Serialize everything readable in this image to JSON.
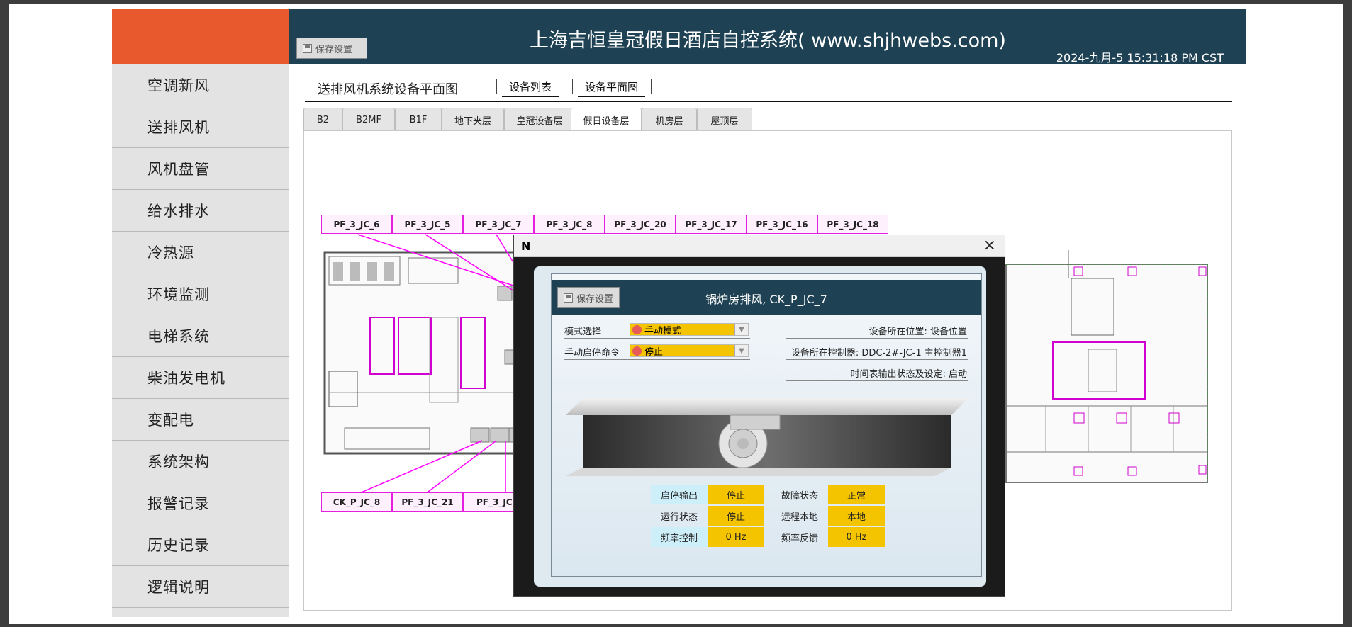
{
  "header": {
    "title": "上海吉恒皇冠假日酒店自控系统( www.shjhwebs.com)",
    "save_label": "保存设置",
    "datetime": "2024-九月-5 15:31:18 PM CST"
  },
  "sidebar": {
    "items": [
      {
        "label": "空调新风"
      },
      {
        "label": "送排风机"
      },
      {
        "label": "风机盘管"
      },
      {
        "label": "给水排水"
      },
      {
        "label": "冷热源"
      },
      {
        "label": "环境监测"
      },
      {
        "label": "电梯系统"
      },
      {
        "label": "柴油发电机"
      },
      {
        "label": "变配电"
      },
      {
        "label": "系统架构"
      },
      {
        "label": "报警记录"
      },
      {
        "label": "历史记录"
      },
      {
        "label": "逻辑说明"
      }
    ]
  },
  "subnav": {
    "title": "送排风机系统设备平面图",
    "links": [
      "设备列表",
      "设备平面图"
    ]
  },
  "tabs": {
    "items": [
      "B2",
      "B2MF",
      "B1F",
      "地下夹层",
      "皇冠设备层",
      "假日设备层",
      "机房层",
      "屋顶层"
    ],
    "active": "假日设备层"
  },
  "devices": {
    "top": [
      "PF_3_JC_6",
      "PF_3_JC_5",
      "PF_3_JC_7",
      "PF_3_JC_8",
      "PF_3_JC_20",
      "PF_3_JC_17",
      "PF_3_JC_16",
      "PF_3_JC_18"
    ],
    "bottom": [
      "CK_P_JC_8",
      "PF_3_JC_21",
      "PF_3_JC_"
    ]
  },
  "dialog": {
    "logo": "N",
    "close": "×",
    "save_label": "保存设置",
    "title": "锅炉房排风, CK_P_JC_7",
    "mode_label": "模式选择",
    "mode_value": "手动模式",
    "cmd_label": "手动启停命令",
    "cmd_value": "停止",
    "location": "设备所在位置: 设备位置",
    "controller": "设备所在控制器: DDC-2#-JC-1 主控制器1",
    "schedule": "时间表输出状态及设定: 启动",
    "status": [
      {
        "label": "启停输出",
        "value": "停止"
      },
      {
        "label": "故障状态",
        "value": "正常"
      },
      {
        "label": "运行状态",
        "value": "停止"
      },
      {
        "label": "远程本地",
        "value": "本地"
      },
      {
        "label": "频率控制",
        "value": "0 Hz"
      },
      {
        "label": "频率反馈",
        "value": "0 Hz"
      }
    ]
  },
  "colors": {
    "accent_orange": "#e85a2e",
    "header_navy": "#1e4154",
    "device_magenta": "#e61ee0",
    "status_yellow": "#f5c400",
    "status_label_cyan": "#cdeffa"
  }
}
